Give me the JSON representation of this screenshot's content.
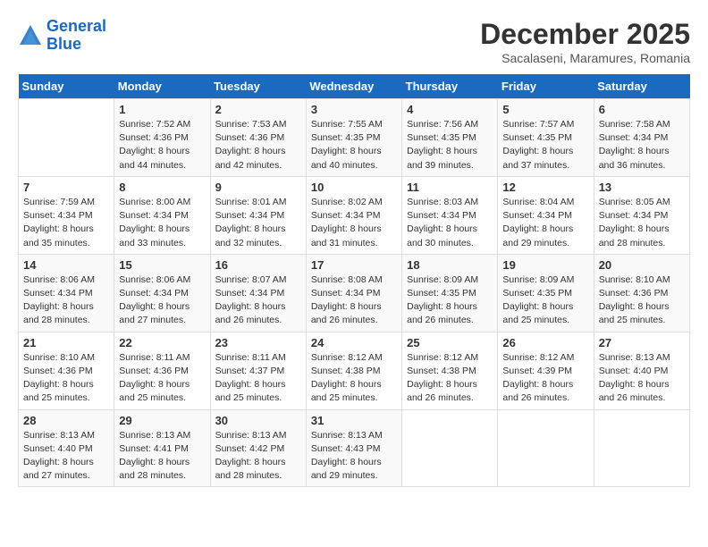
{
  "logo": {
    "line1": "General",
    "line2": "Blue"
  },
  "title": "December 2025",
  "subtitle": "Sacalaseni, Maramures, Romania",
  "days_of_week": [
    "Sunday",
    "Monday",
    "Tuesday",
    "Wednesday",
    "Thursday",
    "Friday",
    "Saturday"
  ],
  "weeks": [
    [
      {
        "day": "",
        "info": ""
      },
      {
        "day": "1",
        "info": "Sunrise: 7:52 AM\nSunset: 4:36 PM\nDaylight: 8 hours\nand 44 minutes."
      },
      {
        "day": "2",
        "info": "Sunrise: 7:53 AM\nSunset: 4:36 PM\nDaylight: 8 hours\nand 42 minutes."
      },
      {
        "day": "3",
        "info": "Sunrise: 7:55 AM\nSunset: 4:35 PM\nDaylight: 8 hours\nand 40 minutes."
      },
      {
        "day": "4",
        "info": "Sunrise: 7:56 AM\nSunset: 4:35 PM\nDaylight: 8 hours\nand 39 minutes."
      },
      {
        "day": "5",
        "info": "Sunrise: 7:57 AM\nSunset: 4:35 PM\nDaylight: 8 hours\nand 37 minutes."
      },
      {
        "day": "6",
        "info": "Sunrise: 7:58 AM\nSunset: 4:34 PM\nDaylight: 8 hours\nand 36 minutes."
      }
    ],
    [
      {
        "day": "7",
        "info": "Sunrise: 7:59 AM\nSunset: 4:34 PM\nDaylight: 8 hours\nand 35 minutes."
      },
      {
        "day": "8",
        "info": "Sunrise: 8:00 AM\nSunset: 4:34 PM\nDaylight: 8 hours\nand 33 minutes."
      },
      {
        "day": "9",
        "info": "Sunrise: 8:01 AM\nSunset: 4:34 PM\nDaylight: 8 hours\nand 32 minutes."
      },
      {
        "day": "10",
        "info": "Sunrise: 8:02 AM\nSunset: 4:34 PM\nDaylight: 8 hours\nand 31 minutes."
      },
      {
        "day": "11",
        "info": "Sunrise: 8:03 AM\nSunset: 4:34 PM\nDaylight: 8 hours\nand 30 minutes."
      },
      {
        "day": "12",
        "info": "Sunrise: 8:04 AM\nSunset: 4:34 PM\nDaylight: 8 hours\nand 29 minutes."
      },
      {
        "day": "13",
        "info": "Sunrise: 8:05 AM\nSunset: 4:34 PM\nDaylight: 8 hours\nand 28 minutes."
      }
    ],
    [
      {
        "day": "14",
        "info": "Sunrise: 8:06 AM\nSunset: 4:34 PM\nDaylight: 8 hours\nand 28 minutes."
      },
      {
        "day": "15",
        "info": "Sunrise: 8:06 AM\nSunset: 4:34 PM\nDaylight: 8 hours\nand 27 minutes."
      },
      {
        "day": "16",
        "info": "Sunrise: 8:07 AM\nSunset: 4:34 PM\nDaylight: 8 hours\nand 26 minutes."
      },
      {
        "day": "17",
        "info": "Sunrise: 8:08 AM\nSunset: 4:34 PM\nDaylight: 8 hours\nand 26 minutes."
      },
      {
        "day": "18",
        "info": "Sunrise: 8:09 AM\nSunset: 4:35 PM\nDaylight: 8 hours\nand 26 minutes."
      },
      {
        "day": "19",
        "info": "Sunrise: 8:09 AM\nSunset: 4:35 PM\nDaylight: 8 hours\nand 25 minutes."
      },
      {
        "day": "20",
        "info": "Sunrise: 8:10 AM\nSunset: 4:36 PM\nDaylight: 8 hours\nand 25 minutes."
      }
    ],
    [
      {
        "day": "21",
        "info": "Sunrise: 8:10 AM\nSunset: 4:36 PM\nDaylight: 8 hours\nand 25 minutes."
      },
      {
        "day": "22",
        "info": "Sunrise: 8:11 AM\nSunset: 4:36 PM\nDaylight: 8 hours\nand 25 minutes."
      },
      {
        "day": "23",
        "info": "Sunrise: 8:11 AM\nSunset: 4:37 PM\nDaylight: 8 hours\nand 25 minutes."
      },
      {
        "day": "24",
        "info": "Sunrise: 8:12 AM\nSunset: 4:38 PM\nDaylight: 8 hours\nand 25 minutes."
      },
      {
        "day": "25",
        "info": "Sunrise: 8:12 AM\nSunset: 4:38 PM\nDaylight: 8 hours\nand 26 minutes."
      },
      {
        "day": "26",
        "info": "Sunrise: 8:12 AM\nSunset: 4:39 PM\nDaylight: 8 hours\nand 26 minutes."
      },
      {
        "day": "27",
        "info": "Sunrise: 8:13 AM\nSunset: 4:40 PM\nDaylight: 8 hours\nand 26 minutes."
      }
    ],
    [
      {
        "day": "28",
        "info": "Sunrise: 8:13 AM\nSunset: 4:40 PM\nDaylight: 8 hours\nand 27 minutes."
      },
      {
        "day": "29",
        "info": "Sunrise: 8:13 AM\nSunset: 4:41 PM\nDaylight: 8 hours\nand 28 minutes."
      },
      {
        "day": "30",
        "info": "Sunrise: 8:13 AM\nSunset: 4:42 PM\nDaylight: 8 hours\nand 28 minutes."
      },
      {
        "day": "31",
        "info": "Sunrise: 8:13 AM\nSunset: 4:43 PM\nDaylight: 8 hours\nand 29 minutes."
      },
      {
        "day": "",
        "info": ""
      },
      {
        "day": "",
        "info": ""
      },
      {
        "day": "",
        "info": ""
      }
    ]
  ]
}
